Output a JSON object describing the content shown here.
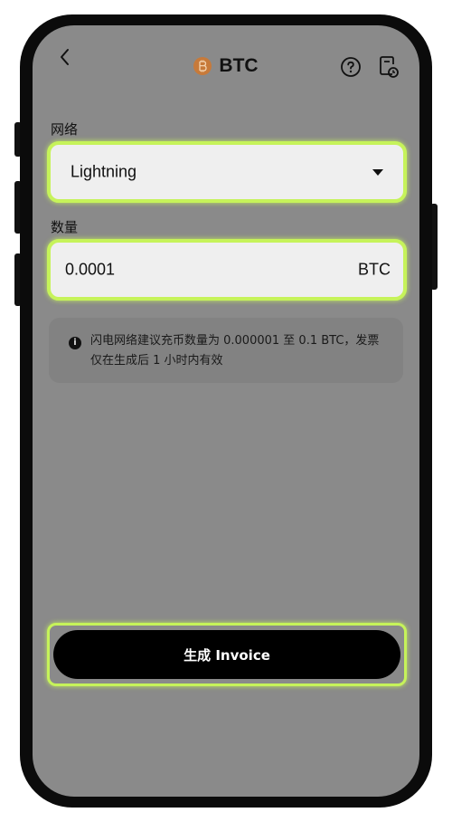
{
  "header": {
    "title": "BTC",
    "back_icon": "chevron-left-icon",
    "coin_icon": "bitcoin-icon",
    "help_icon": "question-circle-icon",
    "history_icon": "history-document-icon"
  },
  "network": {
    "label": "网络",
    "value": "Lightning",
    "caret_icon": "caret-down-icon"
  },
  "amount": {
    "label": "数量",
    "value": "0.0001",
    "unit": "BTC"
  },
  "info": {
    "icon": "info-icon",
    "text": "闪电网络建议充币数量为 0.000001 至 0.1 BTC，发票仅在生成后 1 小时内有效"
  },
  "generate_button": {
    "label": "生成 Invoice"
  },
  "colors": {
    "highlight": "#c6f35a",
    "screen_bg": "#8a8a8a",
    "field_bg": "#efefef",
    "button_bg": "#000000",
    "coin": "#c77a3a"
  }
}
